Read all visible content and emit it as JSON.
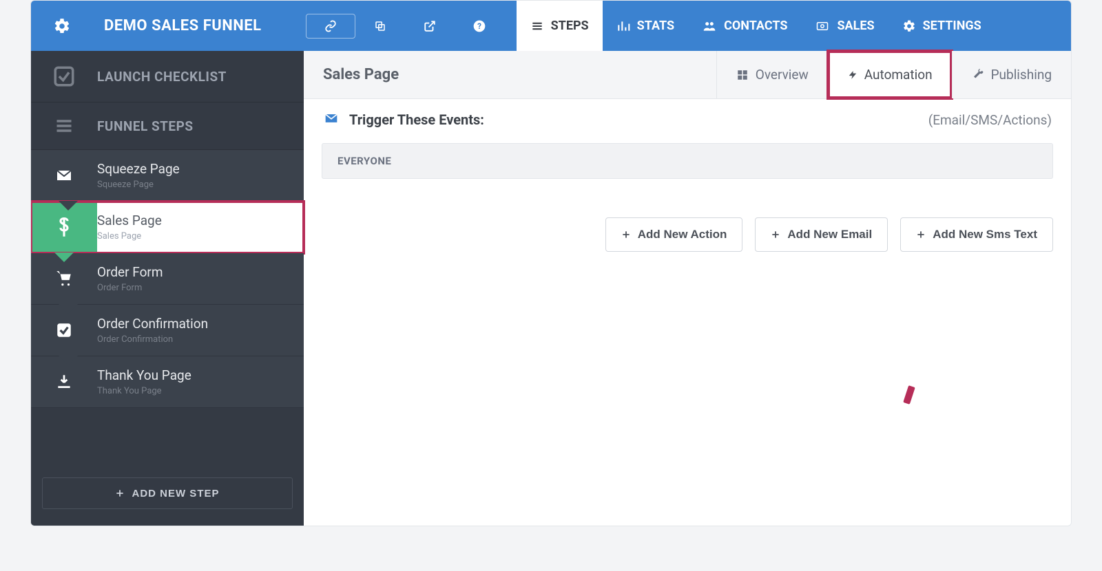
{
  "header": {
    "title": "DEMO SALES FUNNEL",
    "tabs": [
      {
        "label": "STEPS",
        "active": true
      },
      {
        "label": "STATS",
        "active": false
      },
      {
        "label": "CONTACTS",
        "active": false
      },
      {
        "label": "SALES",
        "active": false
      },
      {
        "label": "SETTINGS",
        "active": false
      }
    ]
  },
  "sidebar": {
    "launch_label": "LAUNCH CHECKLIST",
    "funnel_label": "FUNNEL STEPS",
    "steps": [
      {
        "label": "Squeeze Page",
        "sub": "Squeeze Page",
        "icon": "envelope",
        "active": false
      },
      {
        "label": "Sales Page",
        "sub": "Sales Page",
        "icon": "dollar",
        "active": true
      },
      {
        "label": "Order Form",
        "sub": "Order Form",
        "icon": "cart",
        "active": false
      },
      {
        "label": "Order Confirmation",
        "sub": "Order Confirmation",
        "icon": "check",
        "active": false
      },
      {
        "label": "Thank You Page",
        "sub": "Thank You Page",
        "icon": "download",
        "active": false
      }
    ],
    "add_step_label": "ADD NEW STEP"
  },
  "main": {
    "title": "Sales Page",
    "tabs": [
      {
        "label": "Overview",
        "active": false
      },
      {
        "label": "Automation",
        "active": true,
        "highlight": true
      },
      {
        "label": "Publishing",
        "active": false
      }
    ],
    "trigger_label": "Trigger These Events:",
    "trigger_hint": "(Email/SMS/Actions)",
    "everyone_label": "EVERYONE",
    "actions": {
      "add_action": "Add New Action",
      "add_email": "Add New Email",
      "add_sms": "Add New Sms Text"
    }
  }
}
